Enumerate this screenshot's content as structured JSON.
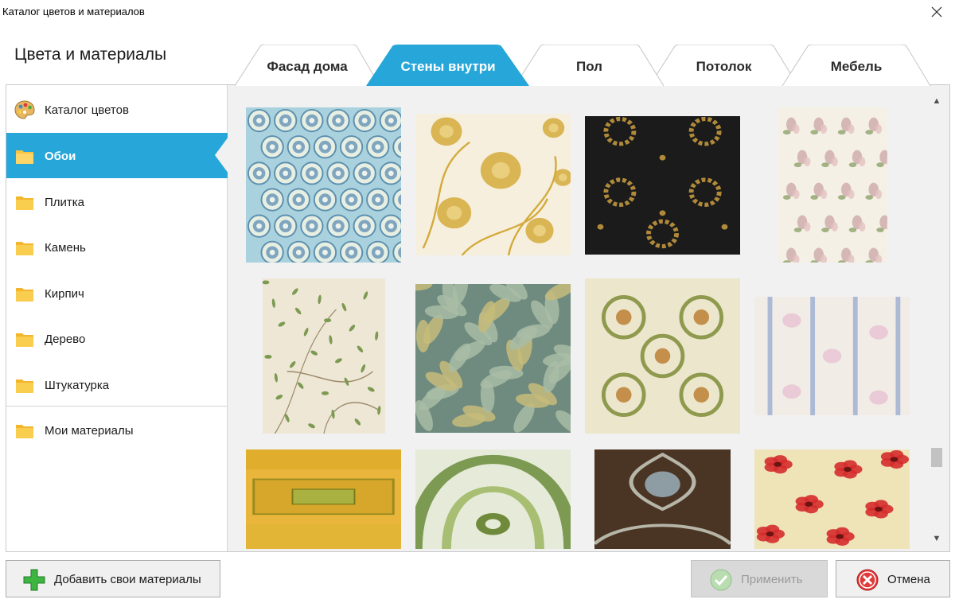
{
  "window": {
    "title": "Каталог цветов и материалов",
    "close_icon": "close-icon"
  },
  "heading": "Цвета и материалы",
  "tabs": [
    {
      "label": "Фасад дома",
      "active": false
    },
    {
      "label": "Стены внутри",
      "active": true
    },
    {
      "label": "Пол",
      "active": false
    },
    {
      "label": "Потолок",
      "active": false
    },
    {
      "label": "Мебель",
      "active": false
    }
  ],
  "colors": {
    "accent": "#27a7d9",
    "panel": "#f1f1f1"
  },
  "sidebar": {
    "items": [
      {
        "label": "Каталог цветов",
        "icon": "palette-icon"
      },
      {
        "label": "Обои",
        "icon": "folder-icon",
        "active": true
      },
      {
        "label": "Плитка",
        "icon": "folder-icon"
      },
      {
        "label": "Камень",
        "icon": "folder-icon"
      },
      {
        "label": "Кирпич",
        "icon": "folder-icon"
      },
      {
        "label": "Дерево",
        "icon": "folder-icon"
      },
      {
        "label": "Штукатурка",
        "icon": "folder-icon"
      },
      {
        "label": "Мои материалы",
        "icon": "folder-icon"
      }
    ]
  },
  "swatches": [
    {
      "name": "blue-circles-wallpaper",
      "bg": "#a9d2de",
      "fg": "#5d8fae",
      "pattern": "circles"
    },
    {
      "name": "gold-poppies-wallpaper",
      "bg": "#f6efdd",
      "fg": "#d4aa3c",
      "pattern": "flowers"
    },
    {
      "name": "black-gold-wreath-wallpaper",
      "bg": "#1b1b1b",
      "fg": "#b08a3a",
      "pattern": "wreath"
    },
    {
      "name": "pink-floral-bouquet-wallpaper",
      "bg": "#f4f0e6",
      "fg": "#c7a0a0",
      "pattern": "bouquet"
    },
    {
      "name": "botanical-branches-wallpaper",
      "bg": "#eee7d5",
      "fg": "#7c9a52",
      "pattern": "branches"
    },
    {
      "name": "green-leaves-wallpaper",
      "bg": "#6f8a7e",
      "fg": "#a8bca6",
      "pattern": "leaves"
    },
    {
      "name": "green-damask-bouquet-wallpaper",
      "bg": "#ebe6cc",
      "fg": "#8f9a4e",
      "pattern": "damask"
    },
    {
      "name": "pastel-stripe-roses-wallpaper",
      "bg": "#f1ece6",
      "fg": "#8fa5cf",
      "pattern": "stripes"
    },
    {
      "name": "yellow-tile-border-wallpaper",
      "bg": "#e9b63b",
      "fg": "#9a8a20",
      "pattern": "tiles"
    },
    {
      "name": "green-retro-arches-wallpaper",
      "bg": "#e6ebd9",
      "fg": "#7c9a52",
      "pattern": "arches"
    },
    {
      "name": "brown-ornament-damask-wallpaper",
      "bg": "#4a3424",
      "fg": "#b6b6a8",
      "pattern": "ornament"
    },
    {
      "name": "red-flowers-wallpaper",
      "bg": "#efe3b8",
      "fg": "#d52c2c",
      "pattern": "redflowers"
    }
  ],
  "scrollbar": {
    "up_icon": "scroll-up-icon",
    "down_icon": "scroll-down-icon"
  },
  "buttons": {
    "add": {
      "label": "Добавить свои материалы",
      "icon": "plus-icon"
    },
    "apply": {
      "label": "Применить",
      "icon": "checkmark-icon",
      "disabled": true
    },
    "cancel": {
      "label": "Отмена",
      "icon": "cancel-icon"
    }
  }
}
